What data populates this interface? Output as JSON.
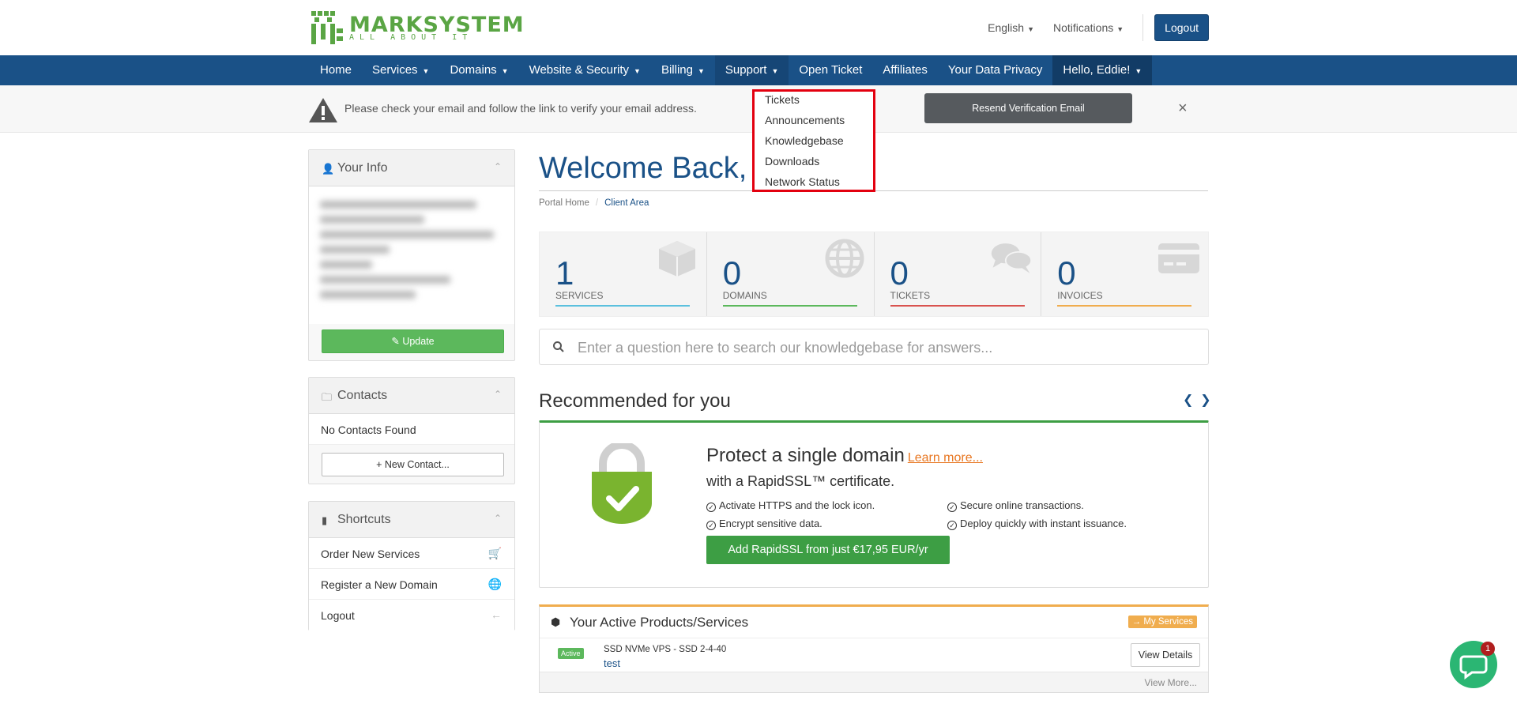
{
  "header": {
    "logo_text": "MARKSYSTEM",
    "logo_tagline": "ALL ABOUT IT",
    "language": "English",
    "notifications": "Notifications",
    "logout": "Logout"
  },
  "nav": {
    "items": [
      {
        "label": "Home",
        "dropdown": false
      },
      {
        "label": "Services",
        "dropdown": true
      },
      {
        "label": "Domains",
        "dropdown": true
      },
      {
        "label": "Website & Security",
        "dropdown": true
      },
      {
        "label": "Billing",
        "dropdown": true
      },
      {
        "label": "Support",
        "dropdown": true
      },
      {
        "label": "Open Ticket",
        "dropdown": false
      },
      {
        "label": "Affiliates",
        "dropdown": false
      },
      {
        "label": "Your Data Privacy",
        "dropdown": false
      },
      {
        "label": "Hello, Eddie!",
        "dropdown": true
      }
    ]
  },
  "support_menu": {
    "items": [
      "Tickets",
      "Announcements",
      "Knowledgebase",
      "Downloads",
      "Network Status"
    ]
  },
  "alert": {
    "text": "Please check your email and follow the link to verify your email address.",
    "button": "Resend Verification Email",
    "close": "×"
  },
  "sidebar": {
    "your_info": {
      "title": "Your Info",
      "button": "Update"
    },
    "contacts": {
      "title": "Contacts",
      "empty": "No Contacts Found",
      "button": "New Contact..."
    },
    "shortcuts": {
      "title": "Shortcuts",
      "items": [
        {
          "label": "Order New Services",
          "icon": "cart-icon"
        },
        {
          "label": "Register a New Domain",
          "icon": "globe-icon"
        },
        {
          "label": "Logout",
          "icon": "arrow-left-icon"
        }
      ]
    }
  },
  "main": {
    "welcome": "Welcome Back,",
    "breadcrumb": {
      "home": "Portal Home",
      "current": "Client Area"
    },
    "tiles": [
      {
        "value": "1",
        "label": "SERVICES",
        "color": "#5bc0de",
        "icon": "cube-icon"
      },
      {
        "value": "0",
        "label": "DOMAINS",
        "color": "#5cb85c",
        "icon": "globe-icon"
      },
      {
        "value": "0",
        "label": "TICKETS",
        "color": "#d9534f",
        "icon": "chat-icon"
      },
      {
        "value": "0",
        "label": "INVOICES",
        "color": "#f0ad4e",
        "icon": "credit-card-icon"
      }
    ],
    "search_placeholder": "Enter a question here to search our knowledgebase for answers...",
    "recommended": {
      "title": "Recommended for you",
      "headline": "Protect a single domain",
      "learn_more": "Learn more...",
      "subheadline": "with a RapidSSL™ certificate.",
      "features": [
        "Activate HTTPS and the lock icon.",
        "Secure online transactions.",
        "Encrypt sensitive data.",
        "Deploy quickly with instant issuance."
      ],
      "button": "Add RapidSSL from just €17,95 EUR/yr"
    },
    "products": {
      "title": "Your Active Products/Services",
      "my_services": "→ My Services",
      "rows": [
        {
          "status": "Active",
          "name": "SSD NVMe VPS - SSD 2-4-40",
          "domain": "test",
          "action": "View Details"
        }
      ],
      "view_more": "View More..."
    }
  },
  "chat": {
    "badge": "1"
  },
  "colors": {
    "brand": "#1a5187",
    "green": "#5cb85c",
    "orange": "#f0ad4e",
    "red": "#e3000f"
  }
}
